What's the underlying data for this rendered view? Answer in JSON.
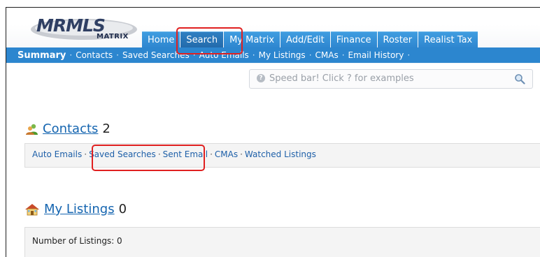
{
  "logo": {
    "brand": "MRMLS",
    "product": "MATRIX"
  },
  "tabs": [
    {
      "label": "Home"
    },
    {
      "label": "Search"
    },
    {
      "label": "My Matrix"
    },
    {
      "label": "Add/Edit"
    },
    {
      "label": "Finance"
    },
    {
      "label": "Roster"
    },
    {
      "label": "Realist Tax"
    }
  ],
  "subnav": [
    {
      "label": "Summary"
    },
    {
      "label": "Contacts"
    },
    {
      "label": "Saved Searches"
    },
    {
      "label": "Auto Emails"
    },
    {
      "label": "My Listings"
    },
    {
      "label": "CMAs"
    },
    {
      "label": "Email History"
    }
  ],
  "speedbar": {
    "placeholder": "Speed bar! Click ? for examples",
    "help_glyph": "?"
  },
  "contacts": {
    "title": "Contacts",
    "count": "2",
    "links": [
      {
        "label": "Auto Emails"
      },
      {
        "label": "Saved Searches"
      },
      {
        "label": "Sent Email"
      },
      {
        "label": "CMAs"
      },
      {
        "label": "Watched Listings"
      }
    ]
  },
  "listings": {
    "title": "My Listings",
    "count": "0",
    "summary": "Number of Listings: 0"
  },
  "colors": {
    "tab_blue": "#2e86cf",
    "link_blue": "#1565b0",
    "highlight_red": "#e02020"
  }
}
